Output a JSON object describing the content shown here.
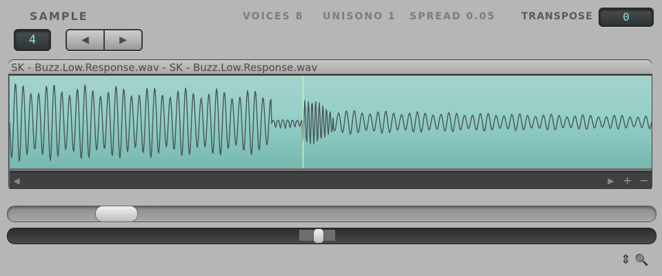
{
  "header": {
    "sample_label": "SAMPLE",
    "sample_number": "4",
    "voices": "VOICES 8",
    "unisono": "UNISONO 1",
    "spread": "SPREAD 0.05",
    "transpose_label": "TRANSPOSE",
    "transpose_value": "0"
  },
  "nav": {
    "prev_icon": "◀",
    "next_icon": "▶"
  },
  "waveform": {
    "title": "SK - Buzz.Low.Response.wav - SK - Buzz.Low.Response.wav",
    "playhead_position": 0.457,
    "background_color": "#93cfc8",
    "waveform_color": "#4a5555"
  },
  "scrollbar": {
    "left_arrow": "◀",
    "right_arrow": "▶",
    "zoom_in": "+",
    "zoom_out": "−"
  },
  "sliders": {
    "slider_top_position": 0.14,
    "slider_bottom_position": 0.49
  },
  "footer": {
    "updown_icon": "⇕",
    "search_icon": "🔍"
  }
}
